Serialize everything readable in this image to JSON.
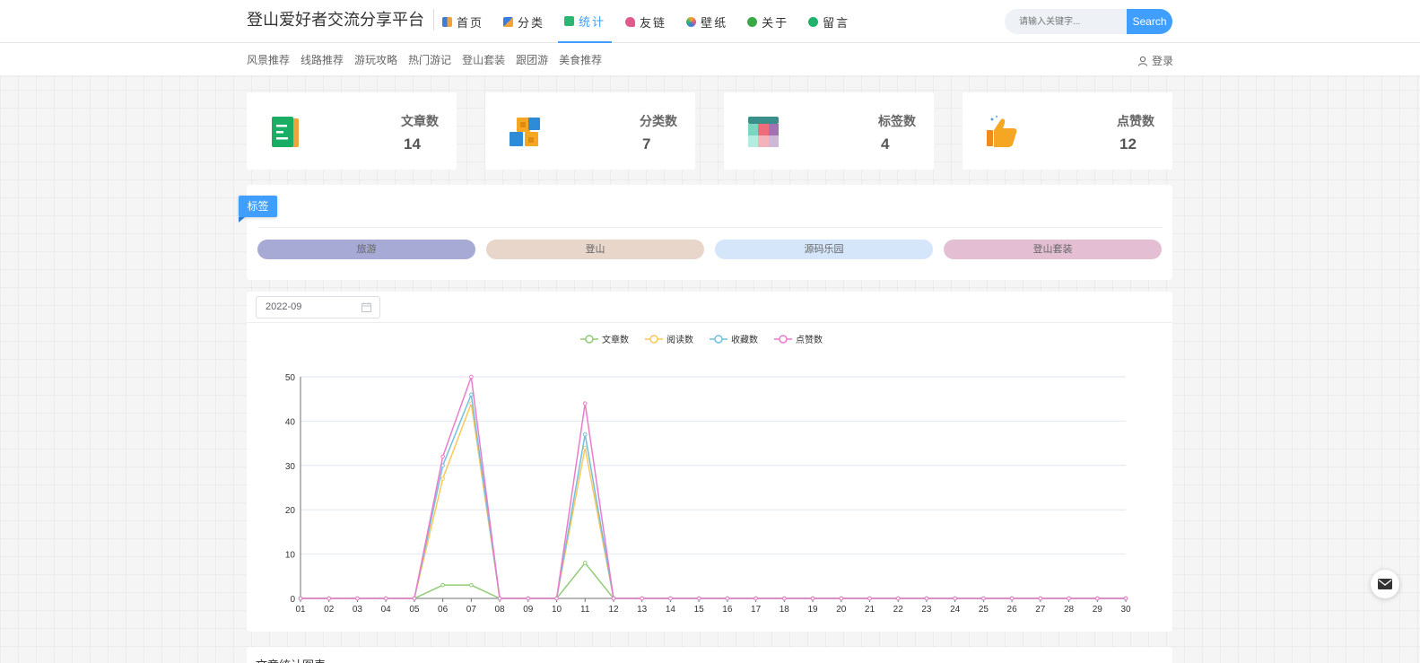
{
  "header": {
    "site_title": "登山爱好者交流分享平台",
    "nav": [
      {
        "label": "首页",
        "icon": "home-icon",
        "color": "#3b7ddd"
      },
      {
        "label": "分类",
        "icon": "category-icon",
        "color": "#f0a23b"
      },
      {
        "label": "统计",
        "icon": "statistics-icon",
        "color": "#2bb673",
        "active": true
      },
      {
        "label": "友链",
        "icon": "friend-link-icon",
        "color": "#e05a8c"
      },
      {
        "label": "壁纸",
        "icon": "wallpaper-icon",
        "color": "#f5a623"
      },
      {
        "label": "关于",
        "icon": "about-icon",
        "color": "#3aa844"
      },
      {
        "label": "留言",
        "icon": "message-icon",
        "color": "#20b26b"
      }
    ],
    "search_placeholder": "请输入关键字...",
    "search_button": "Search"
  },
  "subnav": {
    "items": [
      "风景推荐",
      "线路推荐",
      "游玩攻略",
      "热门游记",
      "登山套装",
      "跟团游",
      "美食推荐"
    ],
    "login_label": "登录"
  },
  "stats": [
    {
      "label": "文章数",
      "value": "14",
      "icon": "article-icon"
    },
    {
      "label": "分类数",
      "value": "7",
      "icon": "category-cubes-icon"
    },
    {
      "label": "标签数",
      "value": "4",
      "icon": "tag-grid-icon"
    },
    {
      "label": "点赞数",
      "value": "12",
      "icon": "thumbs-up-icon"
    }
  ],
  "tags": {
    "title": "标签",
    "items": [
      {
        "label": "旅游",
        "color": "#a6aad5"
      },
      {
        "label": "登山",
        "color": "#e8d6cb"
      },
      {
        "label": "源码乐园",
        "color": "#d5e6fb"
      },
      {
        "label": "登山套装",
        "color": "#e4bfd3"
      }
    ]
  },
  "chart_panel": {
    "date_value": "2022-09"
  },
  "chart_data": {
    "type": "line",
    "categories": [
      "01",
      "02",
      "03",
      "04",
      "05",
      "06",
      "07",
      "08",
      "09",
      "10",
      "11",
      "12",
      "13",
      "14",
      "15",
      "16",
      "17",
      "18",
      "19",
      "20",
      "21",
      "22",
      "23",
      "24",
      "25",
      "26",
      "27",
      "28",
      "29",
      "30"
    ],
    "ylim": [
      0,
      50
    ],
    "yticks": [
      0,
      10,
      20,
      30,
      40,
      50
    ],
    "legend_position": "top-center",
    "grid": true,
    "series": [
      {
        "name": "文章数",
        "color": "#91cc75",
        "values": [
          0,
          0,
          0,
          0,
          0,
          3,
          3,
          0,
          0,
          0,
          8,
          0,
          0,
          0,
          0,
          0,
          0,
          0,
          0,
          0,
          0,
          0,
          0,
          0,
          0,
          0,
          0,
          0,
          0,
          0
        ]
      },
      {
        "name": "阅读数",
        "color": "#fac858",
        "values": [
          0,
          0,
          0,
          0,
          0,
          27,
          44,
          0,
          0,
          0,
          34,
          0,
          0,
          0,
          0,
          0,
          0,
          0,
          0,
          0,
          0,
          0,
          0,
          0,
          0,
          0,
          0,
          0,
          0,
          0
        ]
      },
      {
        "name": "收藏数",
        "color": "#73c0de",
        "values": [
          0,
          0,
          0,
          0,
          0,
          30,
          46,
          0,
          0,
          0,
          37,
          0,
          0,
          0,
          0,
          0,
          0,
          0,
          0,
          0,
          0,
          0,
          0,
          0,
          0,
          0,
          0,
          0,
          0,
          0
        ]
      },
      {
        "name": "点赞数",
        "color": "#ea7ccc",
        "values": [
          0,
          0,
          0,
          0,
          0,
          32,
          50,
          0,
          0,
          0,
          44,
          0,
          0,
          0,
          0,
          0,
          0,
          0,
          0,
          0,
          0,
          0,
          0,
          0,
          0,
          0,
          0,
          0,
          0,
          0
        ]
      }
    ]
  },
  "bottom_panel": {
    "title": "文章统计图表"
  }
}
